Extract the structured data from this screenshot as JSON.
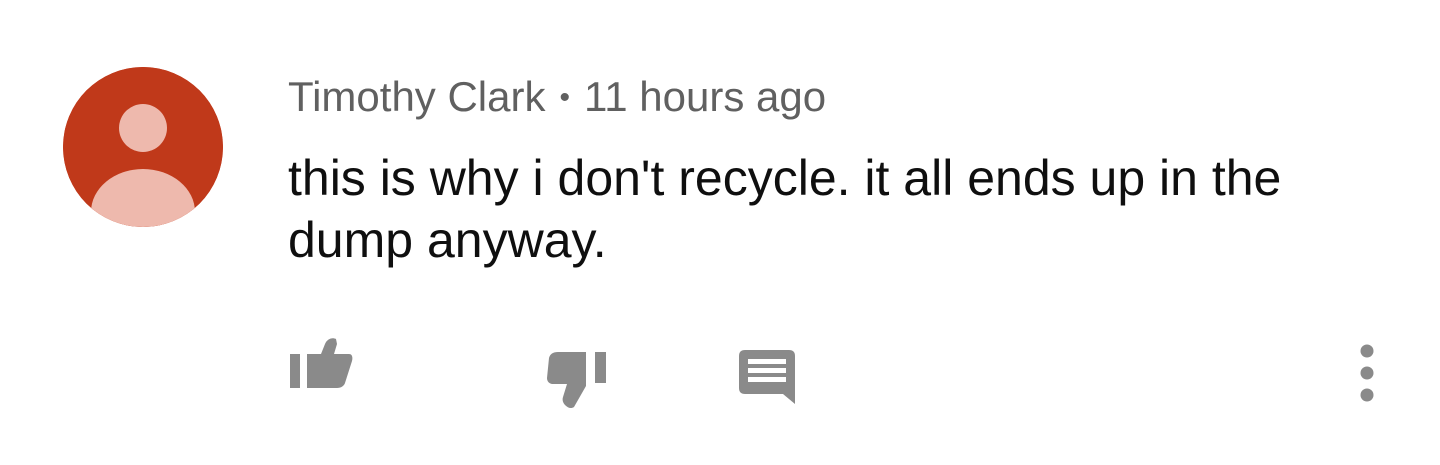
{
  "comment": {
    "author": "Timothy Clark",
    "separator": "•",
    "timestamp": "11 hours ago",
    "text": "this is why i don't recycle. it all ends up in the dump anyway.",
    "avatar_color": "#c0391a",
    "avatar_figure_color": "#eeb9ad"
  },
  "actions": {
    "like_icon": "thumbs-up-icon",
    "dislike_icon": "thumbs-down-icon",
    "reply_icon": "comment-icon",
    "more_icon": "more-vertical-icon",
    "icon_color": "#8a8a8a"
  }
}
